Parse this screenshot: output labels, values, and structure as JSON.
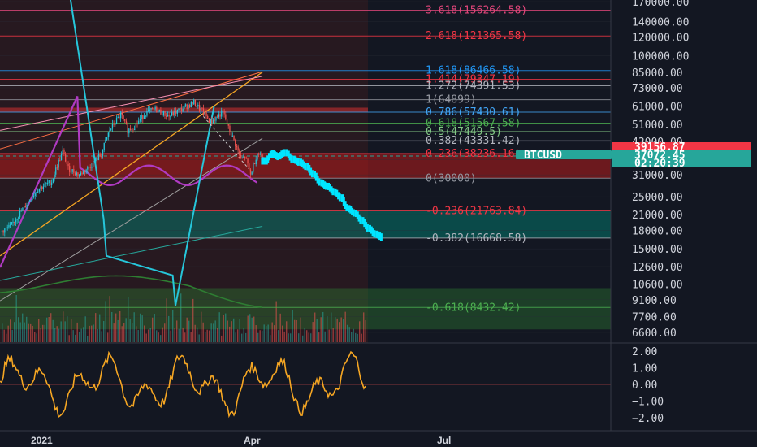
{
  "chart_data": [
    {
      "type": "candlestick",
      "symbol": "BTCUSD",
      "y_scale": "log",
      "ylim": [
        6000,
        180000
      ],
      "y_ticks": [
        "170000.00",
        "140000.00",
        "120000.00",
        "100000.00",
        "85000.00",
        "73000.00",
        "61000.00",
        "51000.00",
        "43000.00",
        "36000.00",
        "31000.00",
        "25000.00",
        "21000.00",
        "18000.00",
        "15000.00",
        "12600.00",
        "10600.00",
        "9100.00",
        "7700.00",
        "6600.00"
      ],
      "x_ticks": [
        "2021",
        "Apr",
        "Jul"
      ],
      "price_tags": [
        {
          "label": "39156.87",
          "color": "#f23645"
        },
        {
          "label": "BTCUSD",
          "color": "#26a69a"
        },
        {
          "label": "37072.45",
          "color": "#26a69a"
        },
        {
          "label": "02:20:39",
          "color": "#26a69a"
        }
      ],
      "fib_levels": [
        {
          "label": "3.618(156264.58)",
          "value": 156264.58,
          "color": "#e1467a"
        },
        {
          "label": "2.618(121365.58)",
          "value": 121365.58,
          "color": "#f23645"
        },
        {
          "label": "1.618(86466.58)",
          "value": 86466.58,
          "color": "#2196f3"
        },
        {
          "label": "1.414(79347.19)",
          "value": 79347.19,
          "color": "#f23645"
        },
        {
          "label": "1.272(74391.53)",
          "value": 74391.53,
          "color": "#b2b5be"
        },
        {
          "label": "1(64899)",
          "value": 64899,
          "color": "#9598a1"
        },
        {
          "label": "0.786(57430.61)",
          "value": 57430.61,
          "color": "#42a5f5"
        },
        {
          "label": "0.618(51567.58)",
          "value": 51567.58,
          "color": "#4caf50"
        },
        {
          "label": "0.5(47449.5)",
          "value": 47449.5,
          "color": "#81c784"
        },
        {
          "label": "0.382(43331.42)",
          "value": 43331.42,
          "color": "#b2b5be"
        },
        {
          "label": "0.236(38236.16)",
          "value": 38236.16,
          "color": "#f23645"
        },
        {
          "label": "0(30000)",
          "value": 30000,
          "color": "#9598a1"
        },
        {
          "label": "-0.236(21763.84)",
          "value": 21763.84,
          "color": "#f23645"
        },
        {
          "label": "-0.382(16668.58)",
          "value": 16668.58,
          "color": "#b2b5be"
        },
        {
          "label": "-0.618(8432.42)",
          "value": 8432.42,
          "color": "#4caf50"
        }
      ],
      "oscillator": {
        "ylim": [
          -2.5,
          2.5
        ],
        "y_ticks": [
          "2.00",
          "1.00",
          "0.00",
          "−1.00",
          "−2.00"
        ],
        "color": "#f5a623"
      },
      "colors": {
        "up": "#26c6da",
        "down": "#ef5350",
        "projection": "#00e5ff",
        "grid": "#2a2e39",
        "text": "#d1d4dc",
        "background": "#131722"
      }
    }
  ]
}
